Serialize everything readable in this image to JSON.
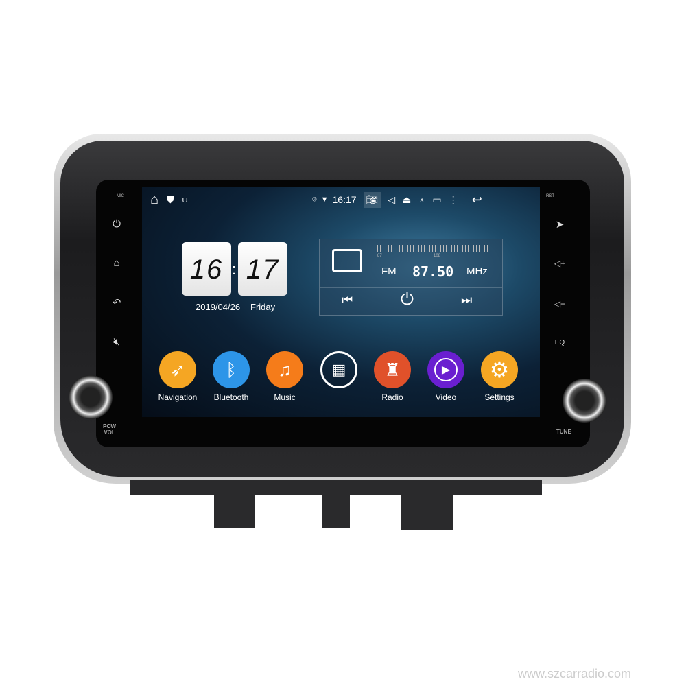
{
  "status_bar": {
    "time": "16:17",
    "icons": [
      "home-icon",
      "shield-icon",
      "usb-icon",
      "location-icon",
      "wifi-icon",
      "camera-icon",
      "volume-icon",
      "eject-icon",
      "close-window-icon",
      "recent-apps-icon",
      "more-icon",
      "back-icon"
    ]
  },
  "hardware": {
    "mic_label": "MIC",
    "rst_label": "RST",
    "pow_vol_label": "POW\nVOL",
    "pow_label": "POW",
    "vol_label": "VOL",
    "tune_label": "TUNE",
    "left_buttons": [
      "power-icon",
      "home-icon",
      "back-icon",
      "mute-icon"
    ],
    "right_buttons": [
      "navigation-icon",
      "volume-up-icon",
      "volume-down-icon",
      "eq-icon"
    ]
  },
  "clock": {
    "hour": "16",
    "minute": "17",
    "date": "2019/04/26",
    "weekday": "Friday"
  },
  "radio": {
    "band": "FM",
    "frequency": "87.50",
    "unit": "MHz",
    "scale_min": "87",
    "scale_max": "108"
  },
  "apps": [
    {
      "label": "Navigation",
      "color": "#f5a623",
      "icon": "compass-icon"
    },
    {
      "label": "Bluetooth",
      "color": "#2d95e8",
      "icon": "bluetooth-icon"
    },
    {
      "label": "Music",
      "color": "#f57c1a",
      "icon": "music-icon"
    },
    {
      "label": "",
      "color": "transparent",
      "icon": "apps-grid-icon"
    },
    {
      "label": "Radio",
      "color": "#e0512a",
      "icon": "radio-tower-icon"
    },
    {
      "label": "Video",
      "color": "#6a1fd0",
      "icon": "play-icon"
    },
    {
      "label": "Settings",
      "color": "#f5a623",
      "icon": "gear-icon"
    }
  ],
  "watermark": "www.szcarradio.com"
}
